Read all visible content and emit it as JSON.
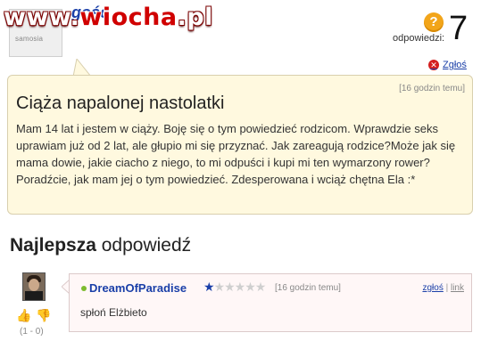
{
  "watermark": {
    "prefix": "www.",
    "brand": "wiocha",
    "suffix": ".pl"
  },
  "asker": {
    "name": "gość",
    "avatar_text": "samosia"
  },
  "stats": {
    "icon": "question-icon",
    "answers_label": "odpowiedzi:",
    "answers_count": "7"
  },
  "question": {
    "report_label": "Zgłoś",
    "time": "[16 godzin temu]",
    "title": "Ciąża napalonej nastolatki",
    "body": "Mam 14 lat i jestem w ciąży. Boję się o tym powiedzieć rodzicom. Wprawdzie seks uprawiam już od 2 lat, ale głupio mi się przyznać. Jak zareagują rodzice?Może jak się mama dowie, jakie ciacho z niego, to mi odpuści i kupi mi ten wymarzony rower? Poradźcie, jak mam jej o tym powiedzieć. Zdesperowana i wciąż chętna Ela :*"
  },
  "best_answer": {
    "heading_bold": "Najlepsza",
    "heading_rest": " odpowiedź",
    "votes": "(1 - 0)",
    "user": "DreamOfParadise",
    "rating": 0.5,
    "time": "[16 godzin temu]",
    "report_label": "zgłoś",
    "separator": " | ",
    "link_label": "link",
    "text": "spłoń Elżbieto"
  },
  "colors": {
    "link": "#1a3fa8",
    "bubble_bg": "#fff9df",
    "answer_bg": "#fff7f7",
    "online": "#7dbb2f"
  }
}
